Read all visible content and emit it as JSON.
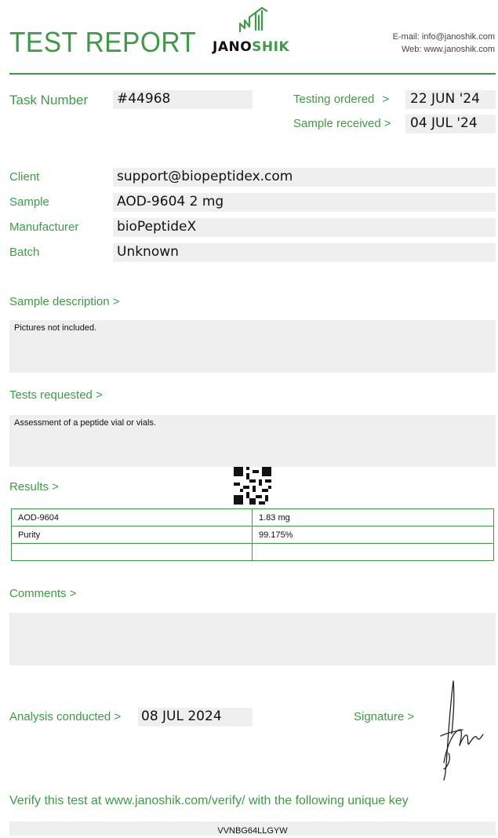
{
  "header": {
    "title": "TEST REPORT",
    "logo_text_a": "JANO",
    "logo_text_b": "SHIK",
    "email_line": "E-mail: info@janoshik.com",
    "web_line": "Web: www.janoshik.com"
  },
  "task": {
    "label": "Task Number",
    "value": "#44968",
    "testing_ordered_label": "Testing ordered",
    "testing_ordered_value": "22 JUN '24",
    "sample_received_label": "Sample received",
    "sample_received_value": "04 JUL '24",
    "arrow": ">"
  },
  "info": [
    {
      "label": "Client",
      "value": "support@biopeptidex.com"
    },
    {
      "label": "Sample",
      "value": "AOD-9604 2 mg"
    },
    {
      "label": "Manufacturer",
      "value": "bioPeptideX"
    },
    {
      "label": "Batch",
      "value": "Unknown"
    }
  ],
  "sample_description": {
    "heading": "Sample description >",
    "text": "Pictures not included."
  },
  "tests_requested": {
    "heading": "Tests requested >",
    "text": "Assessment of a peptide vial or vials."
  },
  "results": {
    "heading": "Results >",
    "rows": [
      {
        "name": "AOD-9604",
        "value": "1.83 mg"
      },
      {
        "name": "Purity",
        "value": "99.175%"
      },
      {
        "name": "",
        "value": ""
      }
    ]
  },
  "comments": {
    "heading": "Comments >",
    "text": ""
  },
  "analysis": {
    "label": "Analysis conducted >",
    "value": "08 JUL 2024",
    "signature_label": "Signature >"
  },
  "verify": {
    "text": "Verify this test at www.janoshik.com/verify/ with the following unique key",
    "key": "VVNBG64LLGYW"
  },
  "colors": {
    "accent": "#3d9b45",
    "field_bg": "#efefef"
  }
}
